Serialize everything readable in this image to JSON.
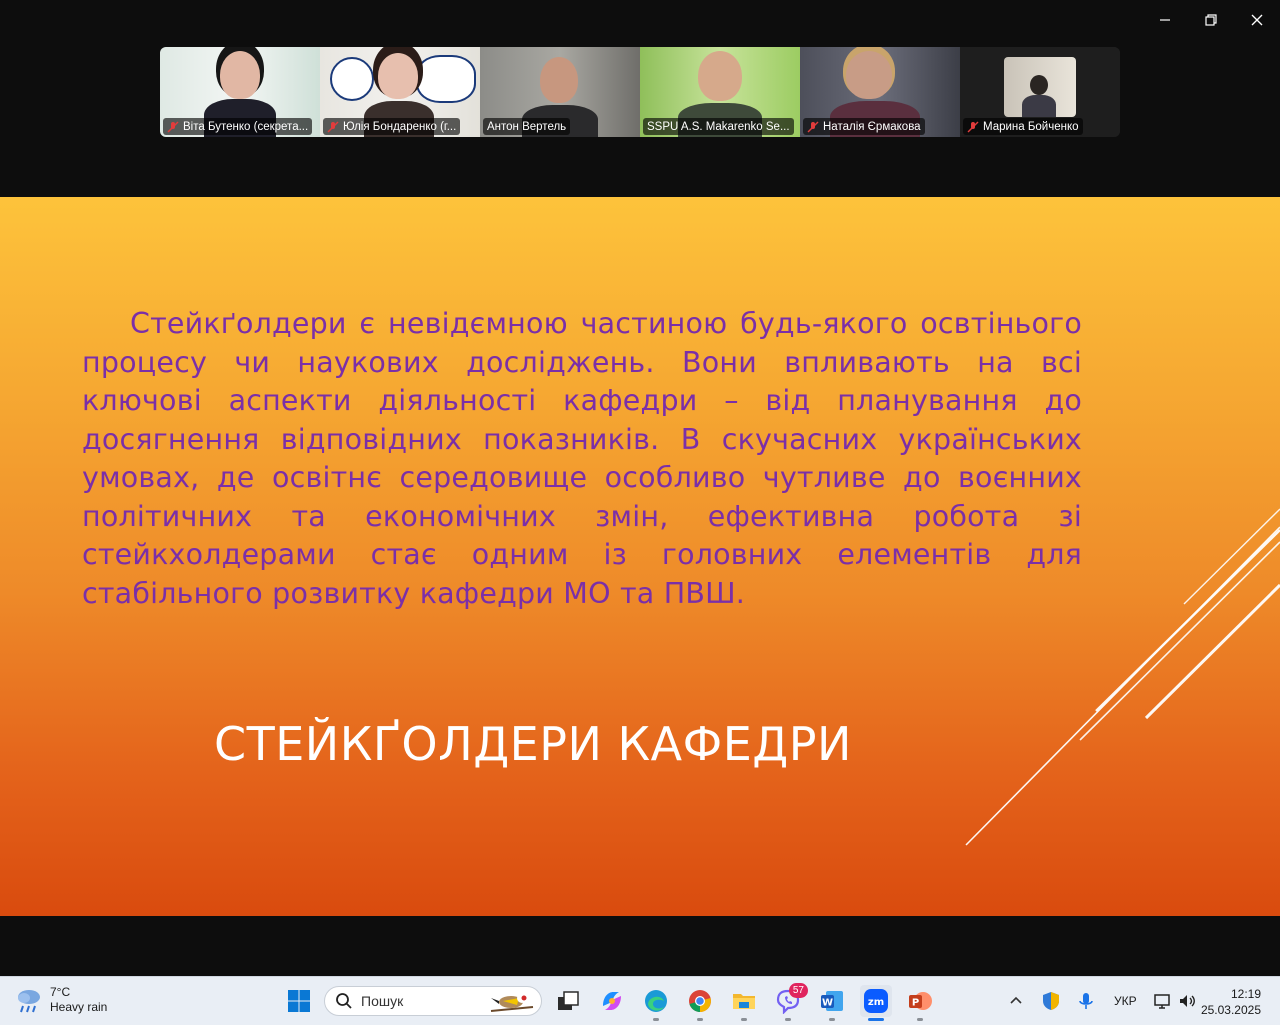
{
  "participants": [
    {
      "name": "Віта Бутенко (секрета...",
      "muted": true
    },
    {
      "name": "Юлія Бондаренко (г...",
      "muted": true
    },
    {
      "name": "Антон Вертель",
      "muted": false
    },
    {
      "name": "SSPU A.S. Makarenko Se...",
      "muted": false
    },
    {
      "name": "Наталія  Єрмакова",
      "muted": true
    },
    {
      "name": "Марина Бойченко",
      "muted": true
    }
  ],
  "slide": {
    "paragraph": "Стейкґолдери є невідємною частиною будь-якого освтінього процесу чи наукових досліджень. Вони впливають на всі ключові аспекти діяльності кафедри – від планування до досягнення відповідних показників. В скучасних українських умовах, де освітнє середовище особливо чутливе до воєнних політичних та економічних змін, ефективна робота зі стейкхолдерами стає одним із головних елементів для стабільного розвитку кафедри МО та ПВШ.",
    "title": "СТЕЙКҐОЛДЕРИ КАФЕДРИ"
  },
  "taskbar": {
    "weather_temp": "7°C",
    "weather_desc": "Heavy rain",
    "search_placeholder": "Пошук",
    "viber_badge": "57",
    "language": "УКР",
    "time": "12:19",
    "date": "25.03.2025"
  },
  "colors": {
    "slide_text": "#7b2fa8",
    "active_speaker": "#2fd86c",
    "taskbar_bg": "#e9eef5"
  }
}
